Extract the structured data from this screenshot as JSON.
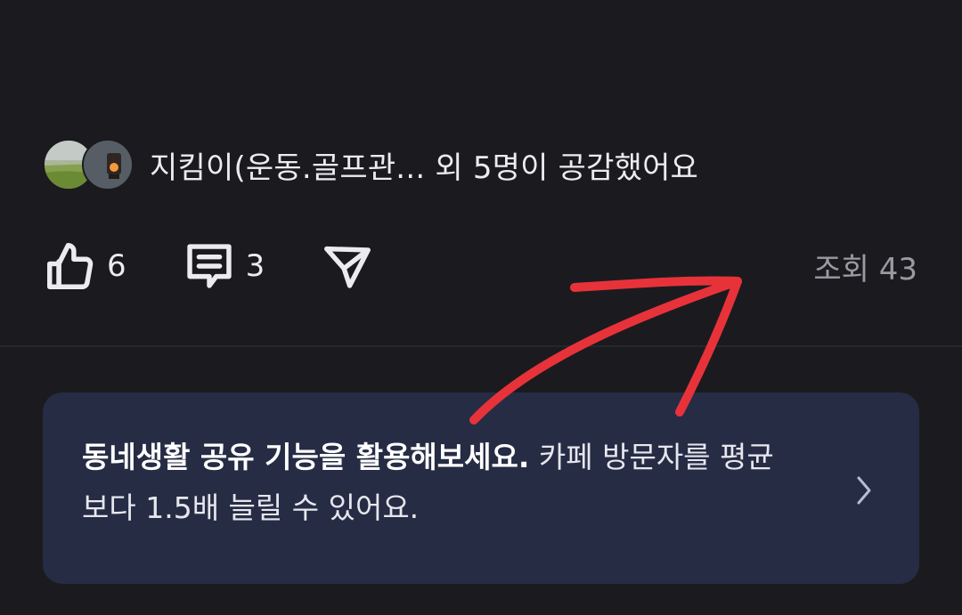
{
  "reactions": {
    "likers_summary": "지킴이(운동.골프관... 외 5명이 공감했어요"
  },
  "actions": {
    "like_count": "6",
    "comment_count": "3",
    "views_label": "조회 43"
  },
  "promo": {
    "headline": "동네생활 공유 기능을 활용해보세요.",
    "body": " 카페 방문자를 평균보다 1.5배 늘릴 수 있어요."
  },
  "icons": {
    "like": "thumbs-up-icon",
    "comment": "comment-icon",
    "share": "paper-plane-icon",
    "chevron": "chevron-right-icon"
  },
  "colors": {
    "background": "#1b1b1f",
    "card": "#262c44",
    "annotation": "#e8323a",
    "muted_text": "#9a9ba1"
  }
}
